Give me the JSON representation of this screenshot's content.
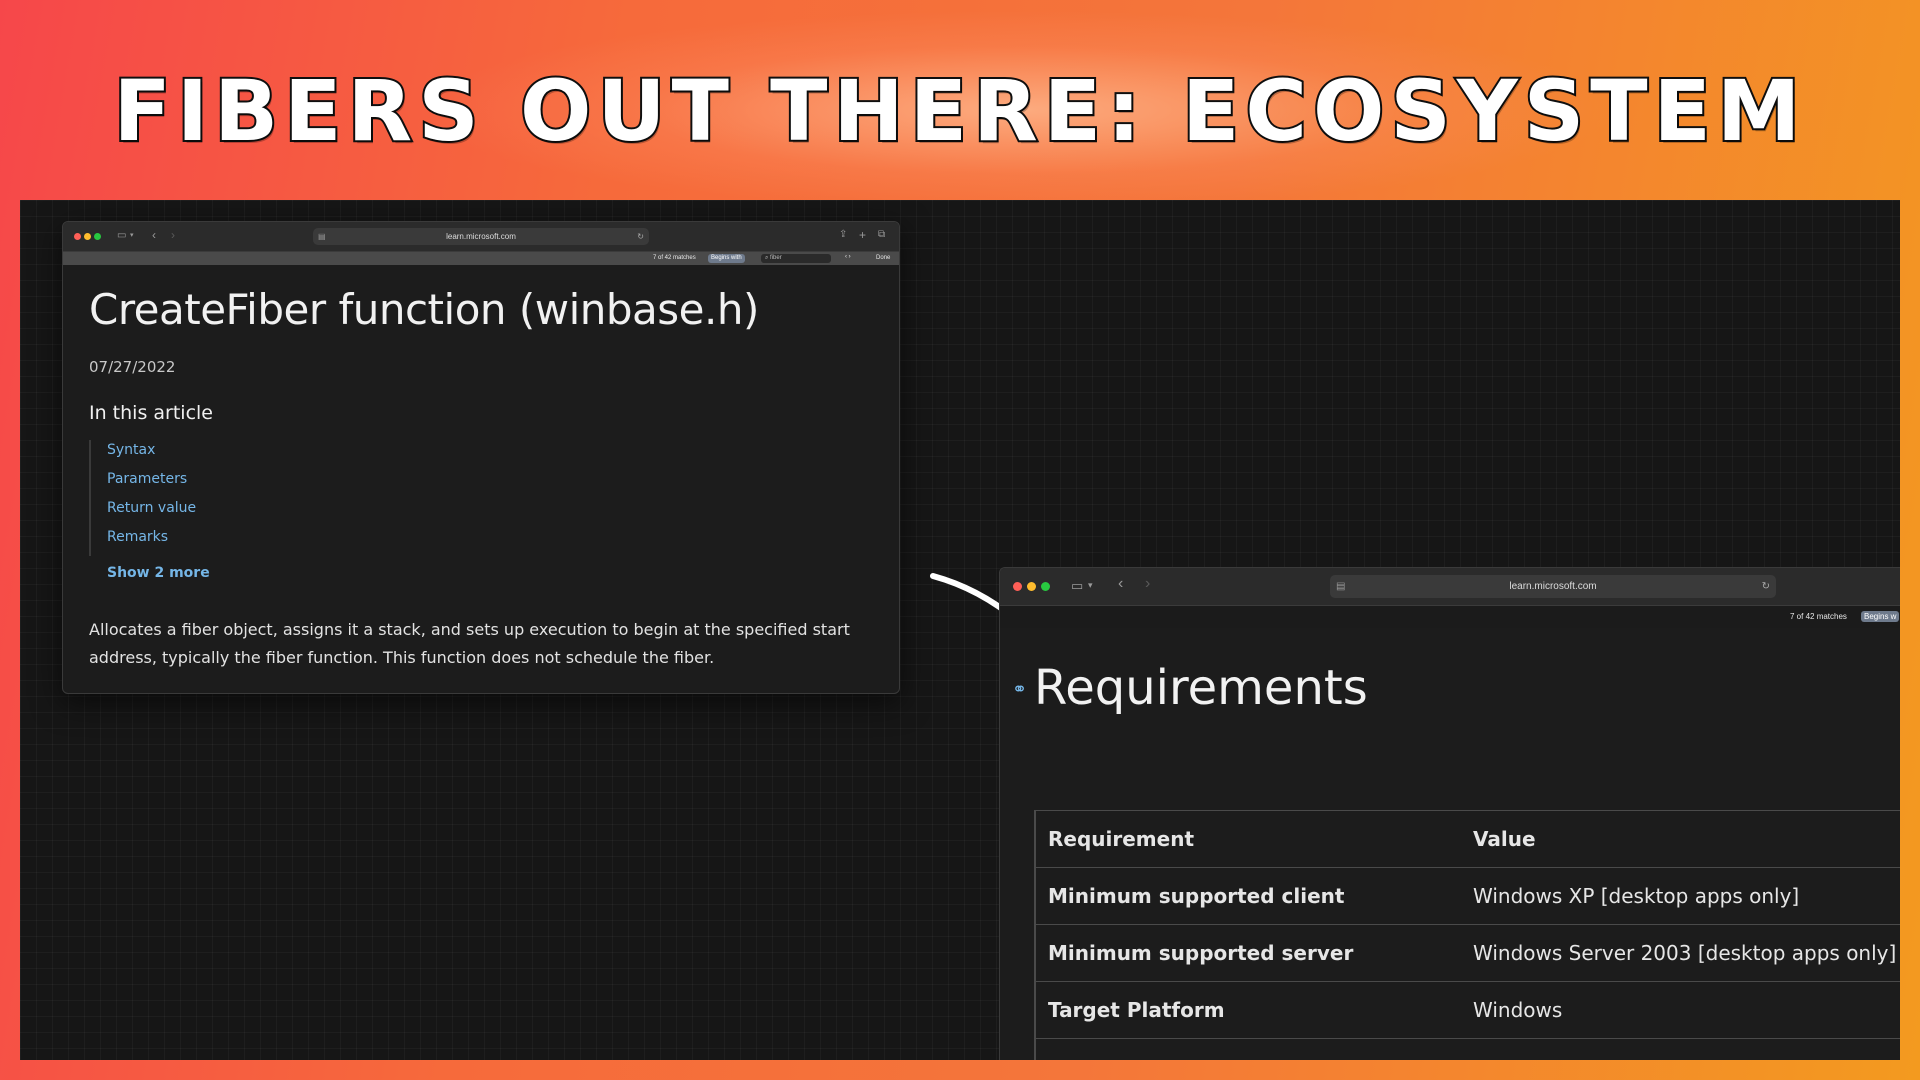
{
  "slide": {
    "title": "FIBERS OUT THERE: ECOSYSTEM"
  },
  "window1": {
    "url": "learn.microsoft.com",
    "find": {
      "matches": "7 of 42 matches",
      "mode": "Begins with",
      "query": "fiber",
      "done": "Done"
    },
    "title": "CreateFiber function (winbase.h)",
    "date": "07/27/2022",
    "toc_heading": "In this article",
    "toc": [
      "Syntax",
      "Parameters",
      "Return value",
      "Remarks"
    ],
    "show_more": "Show 2 more",
    "description": "Allocates a fiber object, assigns it a stack, and sets up execution to begin at the specified start address, typically the fiber function. This function does not schedule the fiber."
  },
  "window2": {
    "url": "learn.microsoft.com",
    "find": {
      "matches": "7 of 42 matches",
      "mode": "Begins w"
    },
    "heading": "Requirements",
    "table": {
      "headers": [
        "Requirement",
        "Value"
      ],
      "rows": [
        [
          "Minimum supported client",
          "Windows XP [desktop apps only]"
        ],
        [
          "Minimum supported server",
          "Windows Server 2003 [desktop apps only]"
        ],
        [
          "Target Platform",
          "Windows"
        ]
      ]
    }
  },
  "icons": {
    "sidebar": "sidebar-icon",
    "back": "chevron-left-icon",
    "forward": "chevron-right-icon",
    "reload": "reload-icon",
    "share": "share-icon",
    "new_tab": "plus-icon",
    "tabs": "tabs-overview-icon",
    "link": "link-icon",
    "arrow": "curved-arrow-icon"
  },
  "colors": {
    "accent_link": "#75b6e7",
    "canvas_bg": "#161616",
    "gradient_left": "#f6474a",
    "gradient_right": "#f39a1f"
  }
}
